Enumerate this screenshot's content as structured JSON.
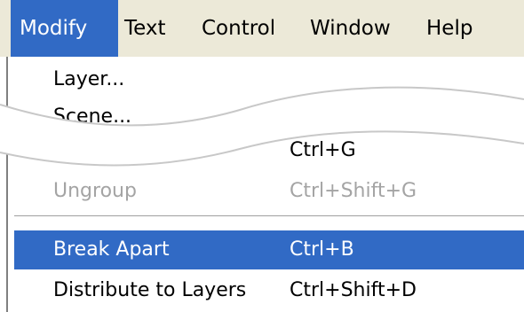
{
  "menubar": {
    "menus": [
      {
        "label": "Modify",
        "active": true
      },
      {
        "label": "Text"
      },
      {
        "label": "Control"
      },
      {
        "label": "Window"
      },
      {
        "label": "Help"
      }
    ]
  },
  "dropdown": {
    "items": [
      {
        "label": "Layer...",
        "shortcut": "",
        "enabled": true
      },
      {
        "label": "Scene...",
        "shortcut": "",
        "enabled": true
      },
      {
        "label": "",
        "shortcut": "Ctrl+G",
        "enabled": true
      },
      {
        "label": "Ungroup",
        "shortcut": "Ctrl+Shift+G",
        "enabled": false
      },
      {
        "label": "Break Apart",
        "shortcut": "Ctrl+B",
        "enabled": true,
        "highlighted": true
      },
      {
        "label": "Distribute to Layers",
        "shortcut": "Ctrl+Shift+D",
        "enabled": true
      }
    ]
  },
  "colors": {
    "highlight": "#316ac5",
    "menubar_bg": "#ece9d8",
    "disabled_text": "#a4a4a4"
  }
}
